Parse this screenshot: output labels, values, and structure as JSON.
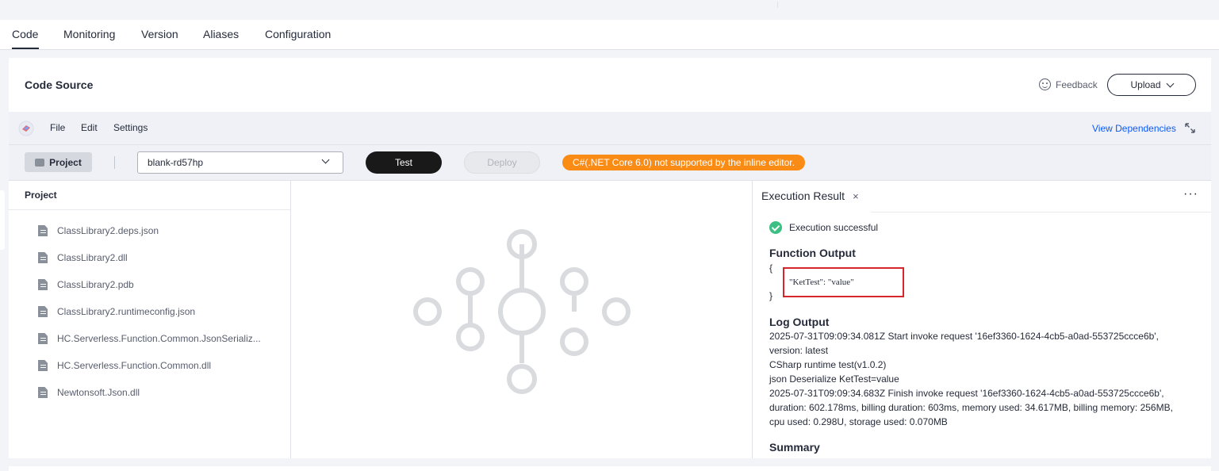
{
  "tabs": [
    "Code",
    "Monitoring",
    "Version",
    "Aliases",
    "Configuration"
  ],
  "active_tab": "Code",
  "card": {
    "title": "Code Source",
    "feedback": "Feedback",
    "upload": "Upload"
  },
  "menu": {
    "file": "File",
    "edit": "Edit",
    "settings": "Settings",
    "view_dependencies": "View Dependencies"
  },
  "toolbar": {
    "project": "Project",
    "function_select": "blank-rd57hp",
    "test": "Test",
    "deploy": "Deploy",
    "warning": "C#(.NET Core 6.0) not supported by the inline editor."
  },
  "project_panel": {
    "title": "Project",
    "files": [
      "ClassLibrary2.deps.json",
      "ClassLibrary2.dll",
      "ClassLibrary2.pdb",
      "ClassLibrary2.runtimeconfig.json",
      "HC.Serverless.Function.Common.JsonSerializ...",
      "HC.Serverless.Function.Common.dll",
      "Newtonsoft.Json.dll"
    ]
  },
  "result": {
    "tab": "Execution Result",
    "close": "×",
    "more": "···",
    "status": "Execution successful",
    "function_output_title": "Function Output",
    "open_brace": "{",
    "output_line": "\"KetTest\": \"value\"",
    "close_brace": "}",
    "log_title": "Log Output",
    "log_lines": [
      "2025-07-31T09:09:34.081Z Start invoke request '16ef3360-1624-4cb5-a0ad-553725ccce6b',",
      "version: latest",
      "CSharp runtime test(v1.0.2)",
      "json Deserialize KetTest=value",
      "2025-07-31T09:09:34.683Z Finish invoke request '16ef3360-1624-4cb5-a0ad-553725ccce6b',",
      "duration: 602.178ms, billing duration: 603ms, memory used: 34.617MB, billing memory: 256MB,",
      "cpu used: 0.298U, storage used: 0.070MB"
    ],
    "summary_title": "Summary"
  },
  "colors": {
    "accent_link": "#0a59f7",
    "warning": "#fa8c16",
    "success": "#3cbf82",
    "highlight_box": "#d7262b"
  }
}
